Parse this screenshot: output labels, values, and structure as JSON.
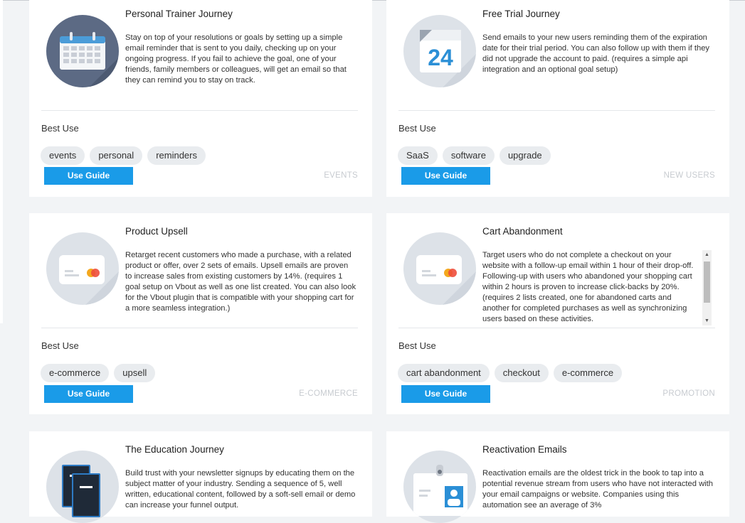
{
  "best_use_label": "Best Use",
  "guide_label": "Use Guide",
  "cards": [
    {
      "title": "Personal Trainer Journey",
      "description": "Stay on top of your resolutions or goals by setting up a simple email reminder that is sent to you daily, checking up on your ongoing progress. If you fail to achieve the goal, one of your friends, family members or colleagues, will get an email so that they can remind you to stay on track.",
      "tags": [
        "events",
        "personal",
        "reminders"
      ],
      "category": "EVENTS",
      "icon": "calendar-icon"
    },
    {
      "title": "Free Trial Journey",
      "description": "Send emails to your new users reminding them of the expiration date for their trial period. You can also follow up with them if they did not upgrade the account to paid. (requires a simple api integration and an optional goal setup)",
      "tags": [
        "SaaS",
        "software",
        "upgrade"
      ],
      "category": "NEW USERS",
      "icon": "calendar-24-icon",
      "icon_text": "24"
    },
    {
      "title": "Product Upsell",
      "description": "Retarget recent customers who made a purchase, with a related product or offer, over 2 sets of emails. Upsell emails are proven to increase sales from existing customers by 14%. (requires 1 goal setup on Vbout as well as one list created. You can also look for the Vbout plugin that is compatible with your shopping cart for a more seamless integration.)",
      "tags": [
        "e-commerce",
        "upsell"
      ],
      "category": "E-COMMERCE",
      "icon": "credit-card-icon"
    },
    {
      "title": "Cart Abandonment",
      "description": "Target users who do not complete a checkout on your website with a follow-up email within 1 hour of their drop-off. Following-up with users who abandoned your shopping cart within 2 hours is proven to increase click-backs by 20%. (requires 2 lists created, one for abandoned carts and another for completed purchases as well as synchronizing users based on these activities.",
      "tags": [
        "cart abandonment",
        "checkout",
        "e-commerce"
      ],
      "category": "PROMOTION",
      "icon": "credit-card-icon"
    },
    {
      "title": "The Education Journey",
      "description": "Build trust with your newsletter signups by educating them on the subject matter of your industry. Sending a sequence of 5, well written, educational content, followed by a soft-sell email or demo can increase your funnel output.",
      "icon": "books-icon"
    },
    {
      "title": "Reactivation Emails",
      "description": "Reactivation emails are the oldest trick in the book to tap into a potential revenue stream from users who have not interacted with your email campaigns or website. Companies using this automation see an average of 3%",
      "icon": "id-badge-icon"
    }
  ]
}
